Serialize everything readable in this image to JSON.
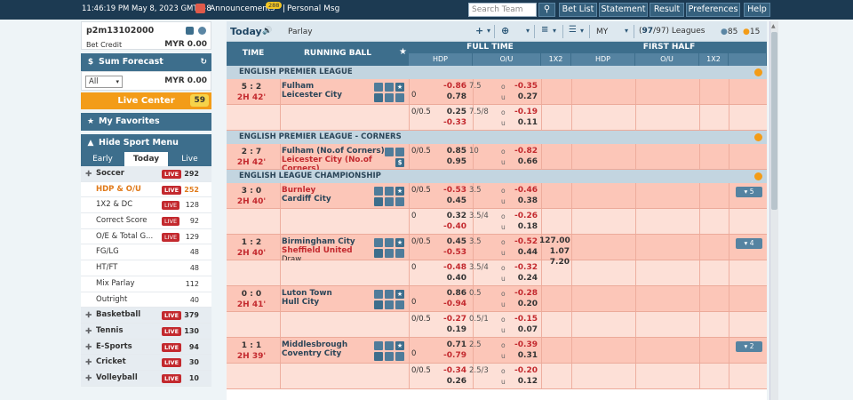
{
  "topbar": {
    "time": "11:46:19 PM May 8, 2023 GMT +8",
    "announcements_label": "Announcements",
    "announcements_badge": "288",
    "separator": "|",
    "personal_msg": "Personal Msg",
    "search_placeholder": "Search Team",
    "search_icon": "magnifier-icon",
    "buttons": [
      "Bet List",
      "Statement",
      "Result",
      "Preferences",
      "Help"
    ]
  },
  "user": {
    "username": "p2m13102000",
    "credit_label": "Bet Credit",
    "credit_value": "MYR  0.00"
  },
  "sum_forecast": {
    "title": "Sum Forecast",
    "select_value": "All",
    "value": "MYR 0.00"
  },
  "live_center": {
    "label": "Live Center",
    "count": "59"
  },
  "favorites": {
    "label": "My Favorites"
  },
  "sport_menu": {
    "title": "Hide Sport Menu",
    "tabs": [
      "Early",
      "Today",
      "Live"
    ],
    "active_tab": "Today",
    "live_badge": "LIVE",
    "rows": [
      {
        "label": "Soccer",
        "count": "292",
        "type": "main"
      },
      {
        "label": "HDP & O/U",
        "count": "252",
        "type": "sub-active"
      },
      {
        "label": "1X2 & DC",
        "count": "128",
        "type": "sub"
      },
      {
        "label": "Correct Score",
        "count": "92",
        "type": "sub"
      },
      {
        "label": "O/E & Total G...",
        "count": "129",
        "type": "sub"
      },
      {
        "label": "FG/LG",
        "count": "48",
        "type": "sub-nolive"
      },
      {
        "label": "HT/FT",
        "count": "48",
        "type": "sub-nolive"
      },
      {
        "label": "Mix Parlay",
        "count": "112",
        "type": "sub-nolive"
      },
      {
        "label": "Outright",
        "count": "40",
        "type": "sub-nolive"
      },
      {
        "label": "Basketball",
        "count": "379",
        "type": "main"
      },
      {
        "label": "Tennis",
        "count": "130",
        "type": "main"
      },
      {
        "label": "E-Sports",
        "count": "94",
        "type": "main"
      },
      {
        "label": "Cricket",
        "count": "30",
        "type": "main"
      },
      {
        "label": "Volleyball",
        "count": "10",
        "type": "main"
      }
    ]
  },
  "toolbar": {
    "title": "Today",
    "mode": "Parlay",
    "currency": "MY",
    "leagues_prefix": "(",
    "leagues_count": "97",
    "leagues_total": "97",
    "leagues_label": ") Leagues",
    "count_a": "85",
    "count_b": "15"
  },
  "table_header": {
    "time": "TIME",
    "running_ball": "RUNNING BALL",
    "full_time": "FULL TIME",
    "first_half": "FIRST HALF",
    "hdp": "HDP",
    "ou": "O/U",
    "x12": "1X2"
  },
  "leagues": [
    {
      "name": "ENGLISH PREMIER LEAGUE",
      "matches": [
        {
          "score": "5 : 2",
          "time": "2H 42'",
          "home": "Fulham",
          "away": "Leicester City",
          "fav": "",
          "lines": [
            {
              "hdp": "0",
              "h_odd": "-0.86",
              "a_odd": "0.78",
              "ou": "7.5",
              "o_odd": "-0.35",
              "u_odd": "0.27"
            },
            {
              "hdp": "0/0.5",
              "h_odd": "0.25",
              "a_odd": "-0.33",
              "ou": "7.5/8",
              "o_odd": "-0.19",
              "u_odd": "0.11"
            }
          ]
        }
      ]
    },
    {
      "name": "ENGLISH PREMIER LEAGUE - CORNERS",
      "matches": [
        {
          "score": "2 : 7",
          "time": "2H 42'",
          "home": "Fulham (No.of Corners)",
          "away": "Leicester City (No.of Corners)",
          "fav": "away",
          "lines": [
            {
              "hdp": "0/0.5",
              "h_odd": "0.85",
              "a_odd": "0.95",
              "ou": "10",
              "o_odd": "-0.82",
              "u_odd": "0.66"
            }
          ]
        }
      ]
    },
    {
      "name": "ENGLISH LEAGUE CHAMPIONSHIP",
      "matches": [
        {
          "score": "3 : 0",
          "time": "2H 40'",
          "home": "Burnley",
          "away": "Cardiff City",
          "fav": "home",
          "more": "5",
          "lines": [
            {
              "hdp": "0/0.5",
              "h_odd": "-0.53",
              "a_odd": "0.45",
              "ou": "3.5",
              "o_odd": "-0.46",
              "u_odd": "0.38"
            },
            {
              "hdp": "0",
              "h_odd": "0.32",
              "a_odd": "-0.40",
              "ou": "3.5/4",
              "o_odd": "-0.26",
              "u_odd": "0.18"
            }
          ]
        },
        {
          "score": "1 : 2",
          "time": "2H 40'",
          "home": "Birmingham City",
          "away": "Sheffield United",
          "draw": "Draw",
          "fav": "away",
          "more": "4",
          "x12": [
            "127.00",
            "1.07",
            "7.20"
          ],
          "lines": [
            {
              "hdp": "0/0.5",
              "h_odd": "0.45",
              "a_odd": "-0.53",
              "ou": "3.5",
              "o_odd": "-0.52",
              "u_odd": "0.44"
            },
            {
              "hdp": "0",
              "h_odd": "-0.48",
              "a_odd": "0.40",
              "ou": "3.5/4",
              "o_odd": "-0.32",
              "u_odd": "0.24"
            }
          ]
        },
        {
          "score": "0 : 0",
          "time": "2H 41'",
          "home": "Luton Town",
          "away": "Hull City",
          "fav": "",
          "lines": [
            {
              "hdp": "0",
              "h_odd": "0.86",
              "a_odd": "-0.94",
              "ou": "0.5",
              "o_odd": "-0.28",
              "u_odd": "0.20"
            },
            {
              "hdp": "0/0.5",
              "h_odd": "-0.27",
              "a_odd": "0.19",
              "ou": "0.5/1",
              "o_odd": "-0.15",
              "u_odd": "0.07"
            }
          ]
        },
        {
          "score": "1 : 1",
          "time": "2H 39'",
          "home": "Middlesbrough",
          "away": "Coventry City",
          "fav": "",
          "more": "2",
          "lines": [
            {
              "hdp": "0",
              "h_odd": "0.71",
              "a_odd": "-0.79",
              "ou": "2.5",
              "o_odd": "-0.39",
              "u_odd": "0.31"
            },
            {
              "hdp": "0/0.5",
              "h_odd": "-0.34",
              "a_odd": "0.26",
              "ou": "2.5/3",
              "o_odd": "-0.20",
              "u_odd": "0.12"
            }
          ]
        }
      ]
    }
  ],
  "ou_labels": {
    "over": "o",
    "under": "u"
  }
}
